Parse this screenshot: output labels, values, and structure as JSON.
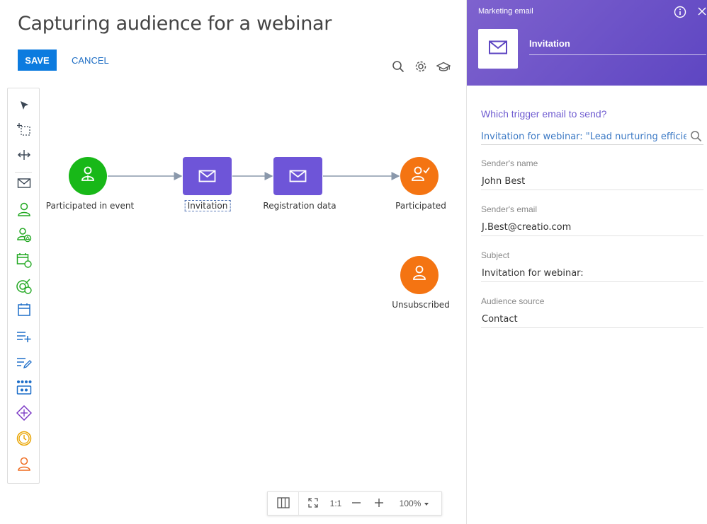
{
  "page": {
    "title": "Capturing audience for a webinar",
    "save_label": "SAVE",
    "cancel_label": "CANCEL"
  },
  "toolbar_icons": [
    "search-icon",
    "gear-icon",
    "graduation-cap-icon"
  ],
  "palette": [
    {
      "name": "pointer-tool",
      "icon": "cursor-arrow-icon"
    },
    {
      "name": "lasso-tool",
      "icon": "selection-rectangle-icon"
    },
    {
      "name": "space-tool",
      "icon": "horizontal-space-icon"
    },
    {
      "name": "marketing-email-element",
      "icon": "envelope-icon"
    },
    {
      "name": "audience-element",
      "icon": "person-icon"
    },
    {
      "name": "add-from-folder-element",
      "icon": "person-add-icon"
    },
    {
      "name": "event-participants-element",
      "icon": "calendar-person-icon"
    },
    {
      "name": "landing-element",
      "icon": "target-person-icon"
    },
    {
      "name": "event-element",
      "icon": "calendar-icon"
    },
    {
      "name": "add-data-element",
      "icon": "add-list-icon"
    },
    {
      "name": "modify-data-element",
      "icon": "edit-list-icon"
    },
    {
      "name": "call-process-element",
      "icon": "process-icon"
    },
    {
      "name": "split-element",
      "icon": "diamond-split-icon"
    },
    {
      "name": "timer-element",
      "icon": "timer-icon"
    },
    {
      "name": "exit-element",
      "icon": "person-exit-icon"
    }
  ],
  "flow": {
    "nodes": [
      {
        "id": "start",
        "label": "Participated in event",
        "kind": "audience-green"
      },
      {
        "id": "invitation",
        "label": "Invitation",
        "kind": "email"
      },
      {
        "id": "registration",
        "label": "Registration data",
        "kind": "email"
      },
      {
        "id": "participated",
        "label": "Participated",
        "kind": "audience-orange-check"
      },
      {
        "id": "unsubscribed",
        "label": "Unsubscribed",
        "kind": "audience-orange"
      }
    ],
    "colors": {
      "green": "#18b818",
      "email": "#6e55d8",
      "orange": "#f47412",
      "connector": "#8a98ab"
    }
  },
  "zoom": {
    "fit_label": "1:1",
    "level": "100%"
  },
  "panel": {
    "type": "Marketing email",
    "element_name": "Invitation",
    "trigger_question": "Which trigger email to send?",
    "trigger_value": "Invitation for webinar: \"Lead nurturing efficienc...",
    "fields": [
      {
        "label": "Sender's name",
        "value": "John Best"
      },
      {
        "label": "Sender's email",
        "value": "J.Best@creatio.com"
      },
      {
        "label": "Subject",
        "value": "Invitation for webinar:"
      },
      {
        "label": "Audience source",
        "value": "Contact"
      }
    ],
    "colors": {
      "header_start": "#7e62ce",
      "header_end": "#5e46c2",
      "accent": "#6e5bd0",
      "link": "#3a78c4"
    }
  }
}
